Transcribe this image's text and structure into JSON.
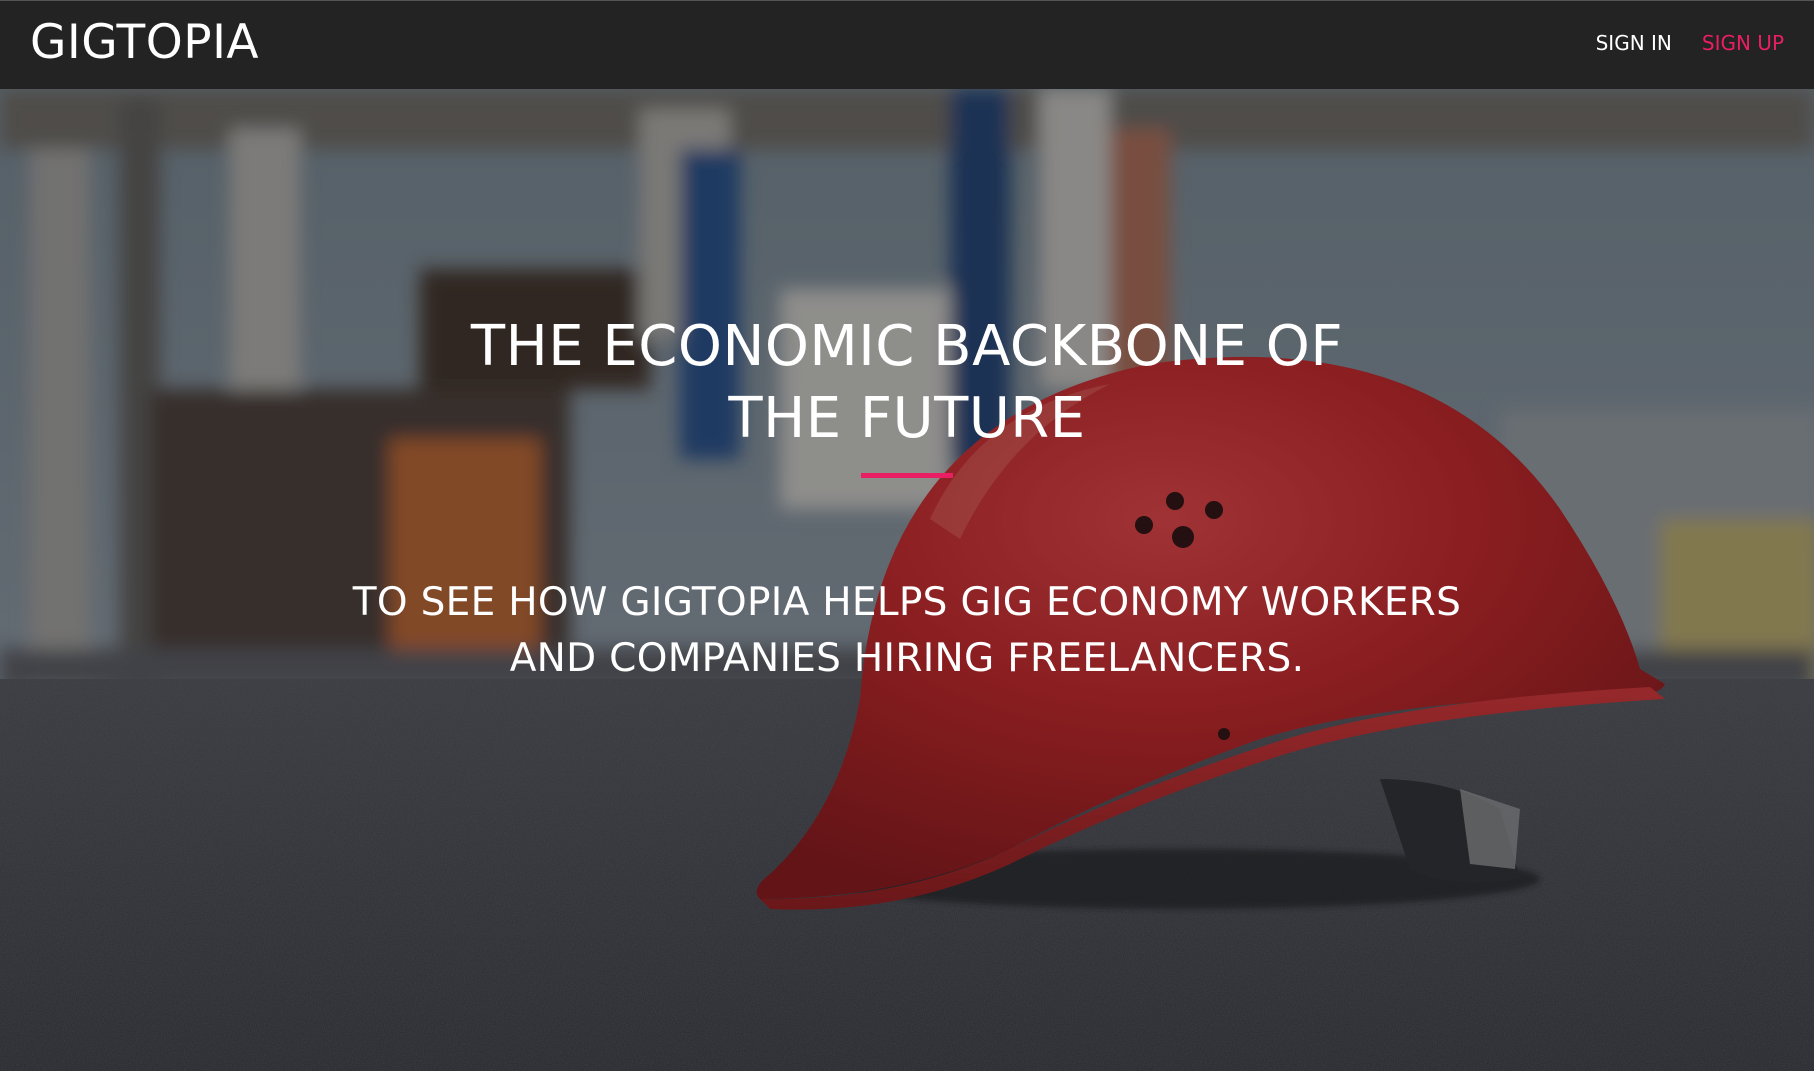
{
  "header": {
    "logo": "GIGTOPIA",
    "nav": {
      "sign_in": "SIGN IN",
      "sign_up": "SIGN UP"
    }
  },
  "hero": {
    "headline_line1": "THE ECONOMIC BACKBONE OF",
    "headline_line2": "THE FUTURE",
    "subhead_line1": "TO SEE HOW GIGTOPIA HELPS GIG ECONOMY WORKERS",
    "subhead_line2": "AND COMPANIES HIRING FREELANCERS.",
    "background_image": "red-hard-hat-on-asphalt-construction-site"
  },
  "colors": {
    "header_bg": "#232323",
    "accent": "#e91e63",
    "text": "#ffffff"
  }
}
